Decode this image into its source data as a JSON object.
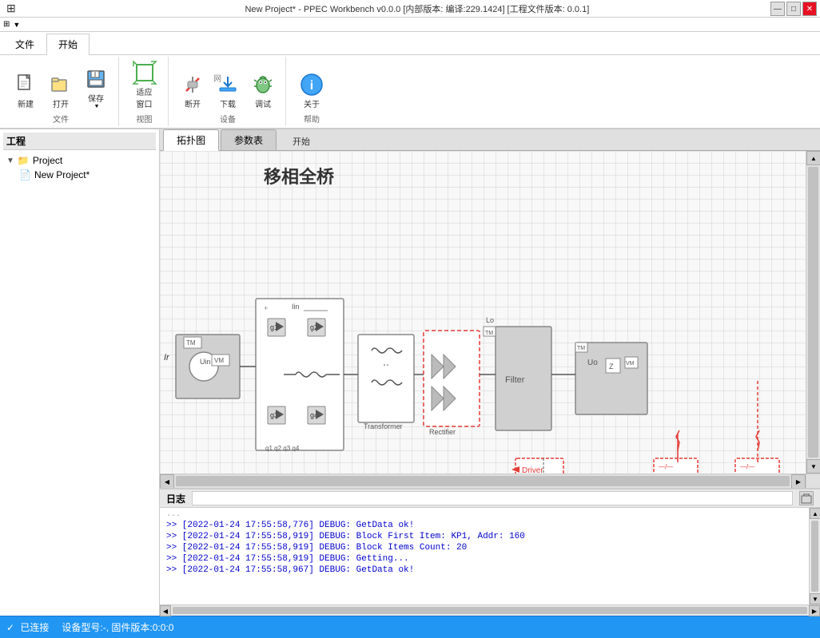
{
  "titleBar": {
    "title": "New Project* - PPEC Workbench v0.0.0 [内部版本: 编译:229.1424] [工程文件版本: 0.0.1]",
    "controls": [
      "—",
      "□",
      "✕"
    ]
  },
  "quickAccess": {
    "icon": "⊞",
    "dropdown": "▼"
  },
  "ribbon": {
    "tabs": [
      {
        "label": "文件",
        "active": false
      },
      {
        "label": "开始",
        "active": true
      }
    ],
    "groups": [
      {
        "name": "文件",
        "items": [
          {
            "label": "新建",
            "icon": "📄"
          },
          {
            "label": "打开",
            "icon": "📂"
          },
          {
            "label": "保存",
            "icon": "💾",
            "hasDropdown": true
          }
        ]
      },
      {
        "name": "视图",
        "items": [
          {
            "label": "适应\n窗口",
            "icon": "⊞"
          }
        ]
      },
      {
        "name": "设备",
        "items": [
          {
            "label": "断开",
            "icon": "⚡"
          },
          {
            "label": "下载",
            "icon": "⬇"
          },
          {
            "label": "调试",
            "icon": "🐛"
          }
        ]
      },
      {
        "name": "帮助",
        "items": [
          {
            "label": "关于",
            "icon": "ℹ"
          }
        ]
      }
    ]
  },
  "sidebar": {
    "title": "工程",
    "tree": [
      {
        "label": "Project",
        "icon": "📁",
        "expanded": true,
        "children": [
          {
            "label": "New Project*",
            "icon": "📄"
          }
        ]
      }
    ]
  },
  "contentTabs": [
    {
      "label": "拓扑图",
      "active": true
    },
    {
      "label": "参数表",
      "active": false
    },
    {
      "label": "开始",
      "active": false,
      "extra": true
    }
  ],
  "diagram": {
    "title": "移相全桥"
  },
  "log": {
    "title": "日志",
    "lines": [
      {
        "text": ">> [2022-01-24 17:55:58,776] DEBUG: GetData ok!",
        "highlight": true
      },
      {
        "text": ">> [2022-01-24 17:55:58,919] DEBUG: Block First Item:  KP1, Addr: 160",
        "highlight": true
      },
      {
        "text": ">> [2022-01-24 17:55:58,919] DEBUG: Block Items Count: 20",
        "highlight": true
      },
      {
        "text": ">> [2022-01-24 17:55:58,919] DEBUG: Getting...",
        "highlight": true
      },
      {
        "text": ">> [2022-01-24 17:55:58,967] DEBUG: GetData ok!",
        "highlight": true
      }
    ]
  },
  "statusBar": {
    "connection": "已连接",
    "deviceInfo": "设备型号:-, 固件版本:0:0:0"
  }
}
